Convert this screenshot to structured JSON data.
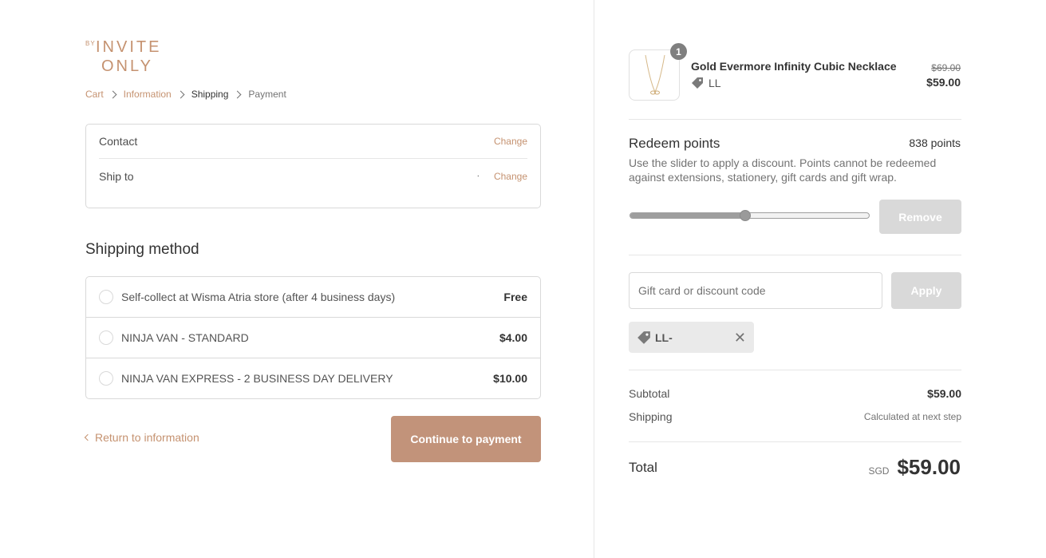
{
  "brand": {
    "by": "BY",
    "line1": "INVITE",
    "line2": "ONLY",
    "color": "#c59270"
  },
  "breadcrumb": {
    "items": [
      {
        "label": "Cart",
        "state": "link"
      },
      {
        "label": "Information",
        "state": "link"
      },
      {
        "label": "Shipping",
        "state": "current"
      },
      {
        "label": "Payment",
        "state": "upcoming"
      }
    ]
  },
  "review": {
    "contact": {
      "label": "Contact",
      "value": "",
      "change": "Change"
    },
    "ship_to": {
      "label": "Ship to",
      "value": "·",
      "change": "Change"
    }
  },
  "shipping_method": {
    "title": "Shipping method",
    "options": [
      {
        "label": "Self-collect at Wisma Atria store (after 4 business days)",
        "price": "Free"
      },
      {
        "label": "NINJA VAN - STANDARD",
        "price": "$4.00"
      },
      {
        "label": "NINJA VAN EXPRESS - 2 BUSINESS DAY DELIVERY",
        "price": "$10.00"
      }
    ]
  },
  "actions": {
    "return_label": "Return to information",
    "continue_label": "Continue to payment"
  },
  "order": {
    "item": {
      "quantity": "1",
      "name": "Gold Evermore Infinity Cubic Necklace",
      "discount_tag": "LL",
      "original_price": "$69.00",
      "final_price": "$59.00"
    },
    "redeem": {
      "title": "Redeem points",
      "points": "838 points",
      "description": "Use the slider to apply a discount. Points cannot be redeemed against extensions, stationery, gift cards and gift wrap.",
      "slider_fraction": 0.48,
      "remove_label": "Remove"
    },
    "discount": {
      "placeholder": "Gift card or discount code",
      "apply_label": "Apply",
      "applied_code": "LL-",
      "remove_symbol": "✕"
    },
    "totals": {
      "subtotal_label": "Subtotal",
      "subtotal_value": "$59.00",
      "shipping_label": "Shipping",
      "shipping_value": "Calculated at next step",
      "total_label": "Total",
      "currency": "SGD",
      "total_value": "$59.00"
    }
  }
}
